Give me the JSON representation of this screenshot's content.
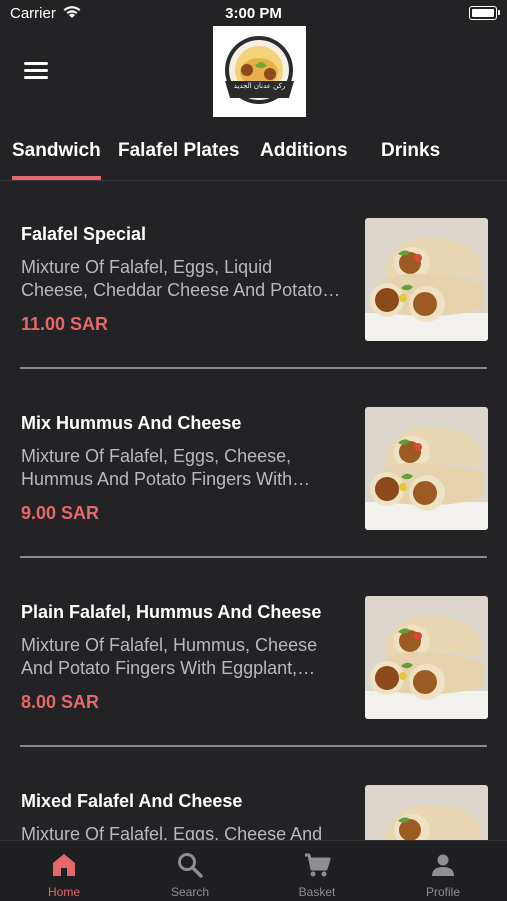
{
  "status_bar": {
    "carrier": "Carrier",
    "time": "3:00 PM"
  },
  "header": {
    "logo_text": "ركن عدنان الجديد",
    "logo_icon": "restaurant-logo"
  },
  "tabs": [
    {
      "label": "Sandwich",
      "active": true
    },
    {
      "label": "Falafel Plates",
      "active": false
    },
    {
      "label": "Additions",
      "active": false
    },
    {
      "label": "Drinks",
      "active": false
    }
  ],
  "items": [
    {
      "name": "Falafel Special",
      "description": "Mixture Of Falafel, Eggs, Liquid Cheese, Cheddar Cheese And Potato Fingers",
      "price": "11.00 SAR"
    },
    {
      "name": "Mix Hummus And Cheese",
      "description": "Mixture Of Falafel, Eggs, Cheese, Hummus And Potato Fingers With Eggplant",
      "price": "9.00 SAR"
    },
    {
      "name": "Plain Falafel, Hummus And Cheese",
      "description": "Mixture Of Falafel, Hummus, Cheese And Potato Fingers With Eggplant, Tomato",
      "price": "8.00 SAR"
    },
    {
      "name": "Mixed Falafel And Cheese",
      "description": "Mixture Of Falafel, Eggs, Cheese And Potato Fingers",
      "price": ""
    }
  ],
  "tabbar": [
    {
      "label": "Home",
      "icon": "home-icon",
      "active": true
    },
    {
      "label": "Search",
      "icon": "search-icon",
      "active": false
    },
    {
      "label": "Basket",
      "icon": "cart-icon",
      "active": false
    },
    {
      "label": "Profile",
      "icon": "person-icon",
      "active": false
    }
  ],
  "colors": {
    "accent": "#e5696b",
    "background": "#232326",
    "tabbar": "#1f1f21",
    "secondary_text": "#b8b8bd"
  }
}
